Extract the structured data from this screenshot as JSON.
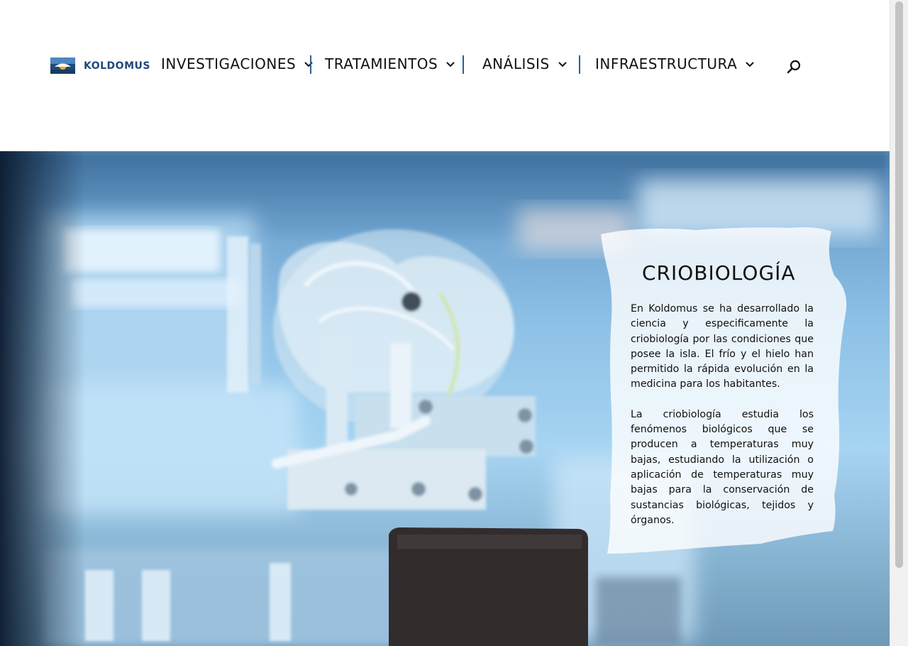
{
  "brand": {
    "name": "KOLDOMUS",
    "colors": {
      "primary": "#1f4a78",
      "accent": "#f5a623",
      "separator": "#2c5f91"
    }
  },
  "nav": {
    "items": [
      {
        "label": "INVESTIGACIONES",
        "icon": "chevron-down-icon"
      },
      {
        "label": "TRATAMIENTOS",
        "icon": "chevron-down-icon"
      },
      {
        "label": "ANÁLISIS",
        "icon": "chevron-down-icon"
      },
      {
        "label": "INFRAESTRUCTURA",
        "icon": "chevron-down-icon"
      }
    ],
    "search_icon": "search-icon"
  },
  "hero": {
    "image": "laboratory-machine-photo",
    "card": {
      "title": "CRIOBIOLOGÍA",
      "paragraphs": [
        "En Koldomus se ha desarrollado la ciencia y especificamente la criobiología por las condiciones que posee la isla. El frío y el hielo han permitido la rápida evolución en la medicina para los habitantes.",
        "La criobiología estudia los fenómenos biológicos que se producen a temperaturas muy bajas, estudiando la utilización o aplicación de temperaturas muy bajas para la conservación de sustancias biológicas, tejidos y órganos."
      ]
    }
  }
}
